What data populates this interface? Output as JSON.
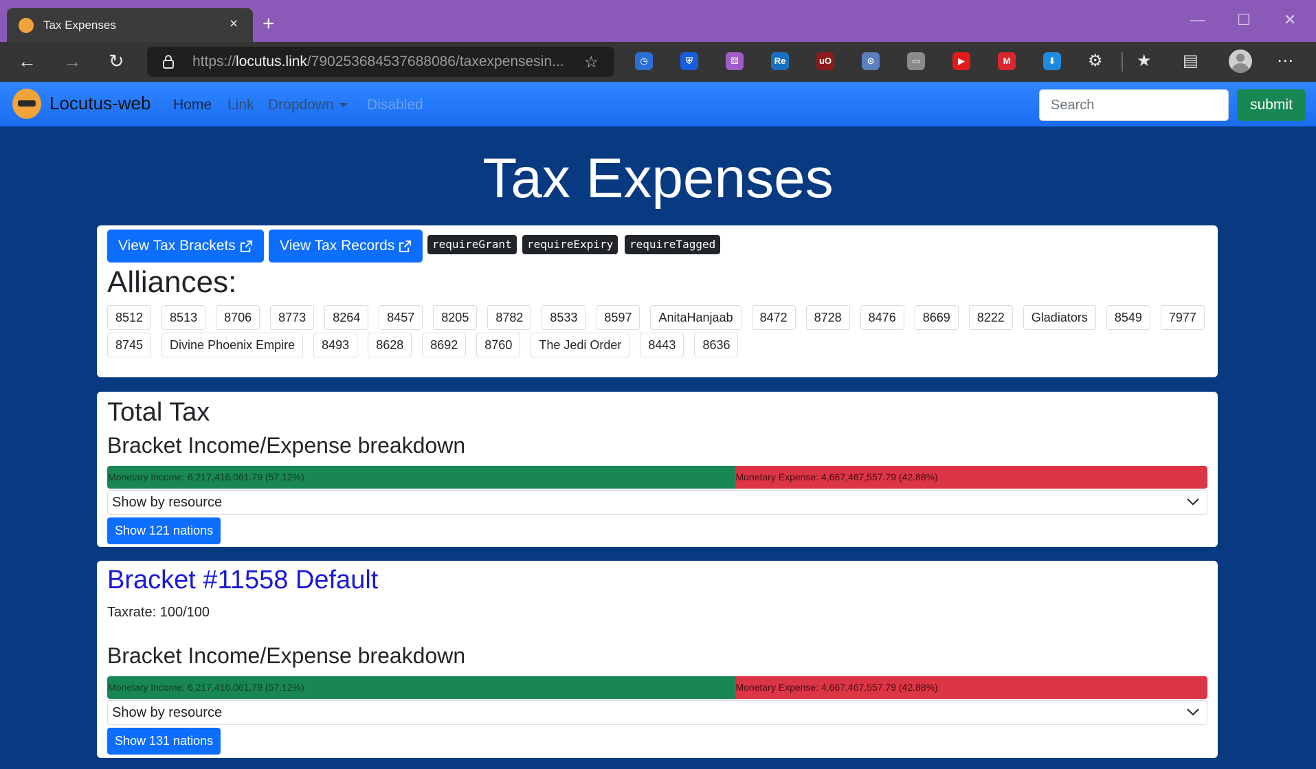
{
  "browser": {
    "tab_title": "Tax Expenses",
    "tab_close": "×",
    "new_tab": "+",
    "url_prefix": "https://",
    "url_domain": "locutus.link",
    "url_path": "/790253684537688086/taxexpensesin...",
    "window_controls": {
      "minimize": "—",
      "maximize": "☐",
      "close": "✕"
    },
    "extensions": [
      {
        "name": "clock-extension-icon",
        "color": "#2b6fd6",
        "glyph": "◷"
      },
      {
        "name": "bitwarden-icon",
        "color": "#175ddc",
        "glyph": "⛨"
      },
      {
        "name": "dice-extension-icon",
        "color": "#a05cc9",
        "glyph": "⚄"
      },
      {
        "name": "re-extension-icon",
        "color": "#1b6fc2",
        "glyph": "Re"
      },
      {
        "name": "ublock-icon",
        "color": "#8e1a1a",
        "glyph": "uO"
      },
      {
        "name": "glasses-extension-icon",
        "color": "#5a7fbf",
        "glyph": "⊙"
      },
      {
        "name": "cast-extension-icon",
        "color": "#8a8a8a",
        "glyph": "▭"
      },
      {
        "name": "youtube-extension-icon",
        "color": "#e21b1b",
        "glyph": "▶"
      },
      {
        "name": "mega-extension-icon",
        "color": "#d9272e",
        "glyph": "M"
      },
      {
        "name": "download-extension-icon",
        "color": "#1f8ae0",
        "glyph": "⬇"
      }
    ]
  },
  "navbar": {
    "brand": "Locutus-web",
    "links": {
      "home": "Home",
      "link": "Link",
      "dropdown": "Dropdown",
      "disabled": "Disabled"
    },
    "search_placeholder": "Search",
    "submit": "submit"
  },
  "page": {
    "title": "Tax Expenses",
    "buttons": {
      "view_brackets": "View Tax Brackets",
      "view_records": "View Tax Records"
    },
    "flags": [
      "requireGrant",
      "requireExpiry",
      "requireTagged"
    ],
    "alliances_title": "Alliances:",
    "alliances": [
      "8512",
      "8513",
      "8706",
      "8773",
      "8264",
      "8457",
      "8205",
      "8782",
      "8533",
      "8597",
      "AnitaHanjaab",
      "8472",
      "8728",
      "8476",
      "8669",
      "8222",
      "Gladiators",
      "8549",
      "7977",
      "8745",
      "Divine Phoenix Empire",
      "8493",
      "8628",
      "8692",
      "8760",
      "The Jedi Order",
      "8443",
      "8636"
    ]
  },
  "total": {
    "title": "Total Tax",
    "breakdown_title": "Bracket Income/Expense breakdown",
    "income_label": "Monetary Income: 6,217,416,061.79 (57.12%)",
    "expense_label": "Monetary Expense: 4,667,467,557.79 (42.88%)",
    "income_fraction": 0.5712,
    "expense_fraction": 0.4288,
    "select_label": "Show by resource",
    "nations_button": "Show 121 nations"
  },
  "bracket": {
    "title": "Bracket #11558 Default",
    "taxrate": "Taxrate: 100/100",
    "breakdown_title": "Bracket Income/Expense breakdown",
    "income_label": "Monetary Income: 6,217,416,061.79 (57.12%)",
    "expense_label": "Monetary Expense: 4,667,467,557.79 (42.88%)",
    "income_fraction": 0.5712,
    "expense_fraction": 0.4288,
    "select_label": "Show by resource",
    "nations_button": "Show 131 nations"
  },
  "colors": {
    "page_bg": "#073a80",
    "navbar": "#2f86ff",
    "primary": "#0d6efd",
    "success": "#198754",
    "danger": "#dc3545",
    "link": "#1a1ad6"
  }
}
